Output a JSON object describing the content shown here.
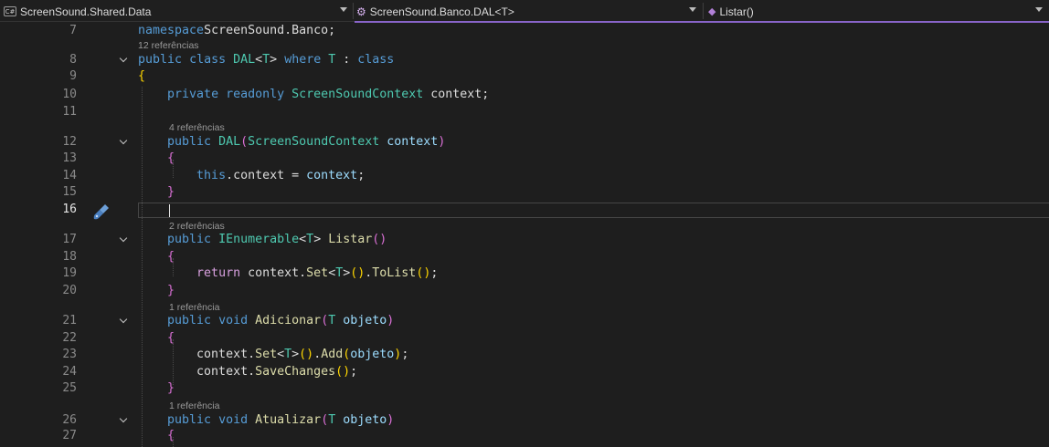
{
  "navbar": {
    "project": "ScreenSound.Shared.Data",
    "project_icon_text": "C#",
    "type": "ScreenSound.Banco.DAL<T>",
    "member": "Listar()"
  },
  "editor": {
    "current_line": "16",
    "rows": [
      {
        "ln": "7",
        "ref": null
      },
      {
        "ln": "8",
        "ref": "12 referências"
      },
      {
        "ln": "9",
        "ref": null
      },
      {
        "ln": "10",
        "ref": null
      },
      {
        "ln": "11",
        "ref": null
      },
      {
        "ln": "12",
        "ref": "4 referências"
      },
      {
        "ln": "13",
        "ref": null
      },
      {
        "ln": "14",
        "ref": null
      },
      {
        "ln": "15",
        "ref": null
      },
      {
        "ln": "16",
        "ref": null
      },
      {
        "ln": "17",
        "ref": "2 referências"
      },
      {
        "ln": "18",
        "ref": null
      },
      {
        "ln": "19",
        "ref": null
      },
      {
        "ln": "20",
        "ref": null
      },
      {
        "ln": "21",
        "ref": "1 referência"
      },
      {
        "ln": "22",
        "ref": null
      },
      {
        "ln": "23",
        "ref": null
      },
      {
        "ln": "24",
        "ref": null
      },
      {
        "ln": "25",
        "ref": null
      },
      {
        "ln": "26",
        "ref": "1 referência"
      },
      {
        "ln": "27",
        "ref": null
      }
    ],
    "code_lines": [
      [
        [
          "kw",
          "namespace"
        ],
        [
          "",
          "ScreenSound"
        ],
        [
          "",
          "."
        ],
        [
          "",
          "Banco;"
        ]
      ],
      [
        [
          "kw",
          "public"
        ],
        [
          "",
          " "
        ],
        [
          "kw",
          "class"
        ],
        [
          "",
          " "
        ],
        [
          "ty",
          "DAL"
        ],
        [
          "",
          "<"
        ],
        [
          "ty",
          "T"
        ],
        [
          "",
          "> "
        ],
        [
          "kw",
          "where"
        ],
        [
          "",
          " "
        ],
        [
          "ty",
          "T"
        ],
        [
          "",
          " : "
        ],
        [
          "kw",
          "class"
        ]
      ],
      [
        [
          "b1",
          "{"
        ]
      ],
      [
        [
          "",
          ""
        ],
        [
          "",
          "    "
        ],
        [
          "kw",
          "private"
        ],
        [
          "",
          " "
        ],
        [
          "kw",
          "readonly"
        ],
        [
          "",
          " "
        ],
        [
          "ty",
          "ScreenSoundContext"
        ],
        [
          "",
          " context;"
        ]
      ],
      [
        [
          "",
          ""
        ]
      ],
      [
        [
          "",
          "    "
        ],
        [
          "kw",
          "public"
        ],
        [
          "",
          " "
        ],
        [
          "ty",
          "DAL"
        ],
        [
          "b2",
          "("
        ],
        [
          "ty",
          "ScreenSoundContext"
        ],
        [
          "",
          " "
        ],
        [
          "pv",
          "context"
        ],
        [
          "b2",
          ")"
        ]
      ],
      [
        [
          "",
          "    "
        ],
        [
          "b2",
          "{"
        ]
      ],
      [
        [
          "",
          "        "
        ],
        [
          "kw",
          "this"
        ],
        [
          "",
          ".context = "
        ],
        [
          "pv",
          "context"
        ],
        [
          "",
          ";"
        ]
      ],
      [
        [
          "",
          "    "
        ],
        [
          "b2",
          "}"
        ]
      ],
      [
        [
          "",
          ""
        ]
      ],
      [
        [
          "",
          "    "
        ],
        [
          "kw",
          "public"
        ],
        [
          "",
          " "
        ],
        [
          "ty",
          "IEnumerable"
        ],
        [
          "",
          "<"
        ],
        [
          "ty",
          "T"
        ],
        [
          "",
          "> "
        ],
        [
          "mt",
          "Listar"
        ],
        [
          "b2",
          "()"
        ]
      ],
      [
        [
          "",
          "    "
        ],
        [
          "b2",
          "{"
        ]
      ],
      [
        [
          "",
          "        "
        ],
        [
          "kw2",
          "return"
        ],
        [
          "",
          " context."
        ],
        [
          "mt",
          "Set"
        ],
        [
          "",
          "<"
        ],
        [
          "ty",
          "T"
        ],
        [
          "",
          ">"
        ],
        [
          "b1",
          "()"
        ],
        [
          "",
          "."
        ],
        [
          "mt",
          "ToList"
        ],
        [
          "b1",
          "()"
        ],
        [
          "",
          ";"
        ]
      ],
      [
        [
          "",
          "    "
        ],
        [
          "b2",
          "}"
        ]
      ],
      [
        [
          "",
          "    "
        ],
        [
          "kw",
          "public"
        ],
        [
          "",
          " "
        ],
        [
          "kw",
          "void"
        ],
        [
          "",
          " "
        ],
        [
          "mt",
          "Adicionar"
        ],
        [
          "b2",
          "("
        ],
        [
          "ty",
          "T"
        ],
        [
          "",
          " "
        ],
        [
          "pv",
          "objeto"
        ],
        [
          "b2",
          ")"
        ]
      ],
      [
        [
          "",
          "    "
        ],
        [
          "b2",
          "{"
        ]
      ],
      [
        [
          "",
          "        context."
        ],
        [
          "mt",
          "Set"
        ],
        [
          "",
          "<"
        ],
        [
          "ty",
          "T"
        ],
        [
          "",
          ">"
        ],
        [
          "b1",
          "()"
        ],
        [
          "",
          "."
        ],
        [
          "mt",
          "Add"
        ],
        [
          "b1",
          "("
        ],
        [
          "pv",
          "objeto"
        ],
        [
          "b1",
          ")"
        ],
        [
          "",
          ";"
        ]
      ],
      [
        [
          "",
          "        context."
        ],
        [
          "mt",
          "SaveChanges"
        ],
        [
          "b1",
          "()"
        ],
        [
          "",
          ";"
        ]
      ],
      [
        [
          "",
          "    "
        ],
        [
          "b2",
          "}"
        ]
      ],
      [
        [
          "",
          "    "
        ],
        [
          "kw",
          "public"
        ],
        [
          "",
          " "
        ],
        [
          "kw",
          "void"
        ],
        [
          "",
          " "
        ],
        [
          "mt",
          "Atualizar"
        ],
        [
          "b2",
          "("
        ],
        [
          "ty",
          "T"
        ],
        [
          "",
          " "
        ],
        [
          "pv",
          "objeto"
        ],
        [
          "b2",
          ")"
        ]
      ],
      [
        [
          "",
          "    "
        ],
        [
          "b2",
          "{"
        ]
      ]
    ],
    "folded_lines": [
      "8",
      "12",
      "17",
      "21",
      "26"
    ]
  }
}
